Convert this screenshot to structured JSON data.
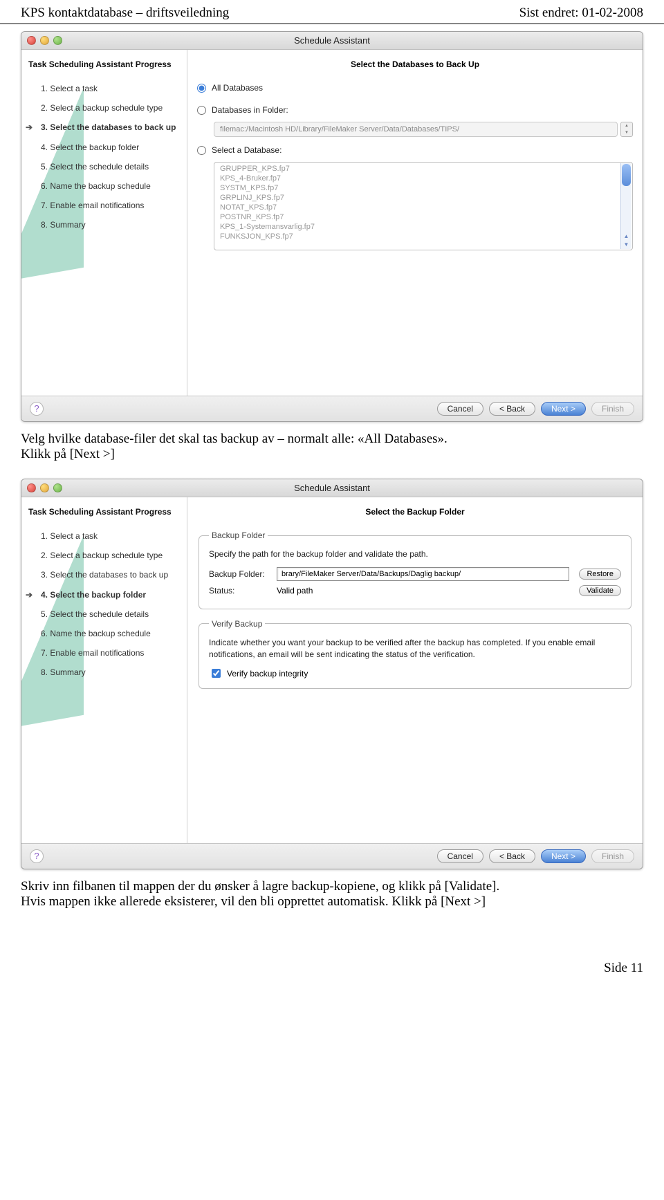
{
  "doc": {
    "header_left": "KPS kontaktdatabase – driftsveiledning",
    "header_right": "Sist endret: 01-02-2008",
    "footer": "Side 11"
  },
  "captions": {
    "c1": "Velg hvilke database-filer det skal tas backup av – normalt alle: «All Databases».\nKlikk på [Next >]",
    "c2": "Skriv inn filbanen til mappen der du ønsker å lagre backup-kopiene, og klikk på [Validate].\nHvis mappen ikke allerede eksisterer, vil den bli opprettet automatisk. Klikk på [Next >]"
  },
  "window": {
    "title": "Schedule Assistant",
    "sidebar_title": "Task Scheduling Assistant Progress",
    "steps": [
      "1. Select a task",
      "2. Select a backup schedule type",
      "3. Select the databases to back up",
      "4. Select the backup folder",
      "5. Select the schedule details",
      "6. Name the backup schedule",
      "7. Enable email notifications",
      "8. Summary"
    ],
    "footer": {
      "cancel": "Cancel",
      "back": "< Back",
      "next": "Next >",
      "finish": "Finish"
    }
  },
  "screen1": {
    "active_step": 2,
    "title": "Select the Databases to Back Up",
    "radios": {
      "all": "All Databases",
      "folder": "Databases in Folder:",
      "select": "Select a Database:"
    },
    "folder_path": "filemac:/Macintosh HD/Library/FileMaker Server/Data/Databases/TIPS/",
    "db_list": [
      "GRUPPER_KPS.fp7",
      "KPS_4-Bruker.fp7",
      "SYSTM_KPS.fp7",
      "GRPLINJ_KPS.fp7",
      "NOTAT_KPS.fp7",
      "POSTNR_KPS.fp7",
      "KPS_1-Systemansvarlig.fp7",
      "FUNKSJON_KPS.fp7"
    ]
  },
  "screen2": {
    "active_step": 3,
    "title": "Select the Backup Folder",
    "group1": {
      "legend": "Backup Folder",
      "desc": "Specify the path for the backup folder and validate the path.",
      "label": "Backup Folder:",
      "value": "brary/FileMaker Server/Data/Backups/Daglig backup/",
      "restore": "Restore",
      "status_label": "Status:",
      "status_value": "Valid path",
      "validate": "Validate"
    },
    "group2": {
      "legend": "Verify Backup",
      "desc": "Indicate whether you want your backup to be verified after the backup has completed.  If you enable email notifications, an email will be sent indicating the status of the verification.",
      "checkbox": "Verify backup integrity"
    }
  }
}
